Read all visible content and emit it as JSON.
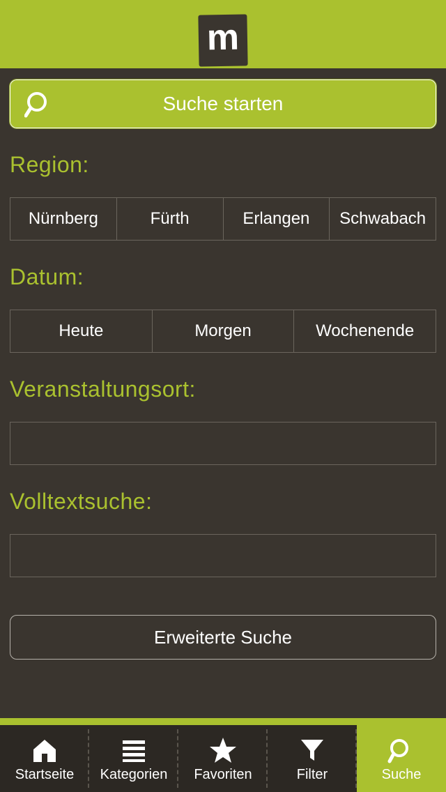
{
  "header": {
    "logo_text": "m"
  },
  "search_button_label": "Suche starten",
  "labels": {
    "region": "Region:",
    "date": "Datum:",
    "venue": "Veranstaltungsort:",
    "fulltext": "Volltextsuche:"
  },
  "regions": [
    "Nürnberg",
    "Fürth",
    "Erlangen",
    "Schwabach"
  ],
  "dates": [
    "Heute",
    "Morgen",
    "Wochenende"
  ],
  "fields": {
    "venue_value": "",
    "fulltext_value": ""
  },
  "advanced_label": "Erweiterte Suche",
  "nav": {
    "items": [
      {
        "label": "Startseite"
      },
      {
        "label": "Kategorien"
      },
      {
        "label": "Favoriten"
      },
      {
        "label": "Filter"
      },
      {
        "label": "Suche"
      }
    ],
    "active_index": 4
  },
  "colors": {
    "accent": "#aac12f",
    "bg": "#3a352f"
  }
}
